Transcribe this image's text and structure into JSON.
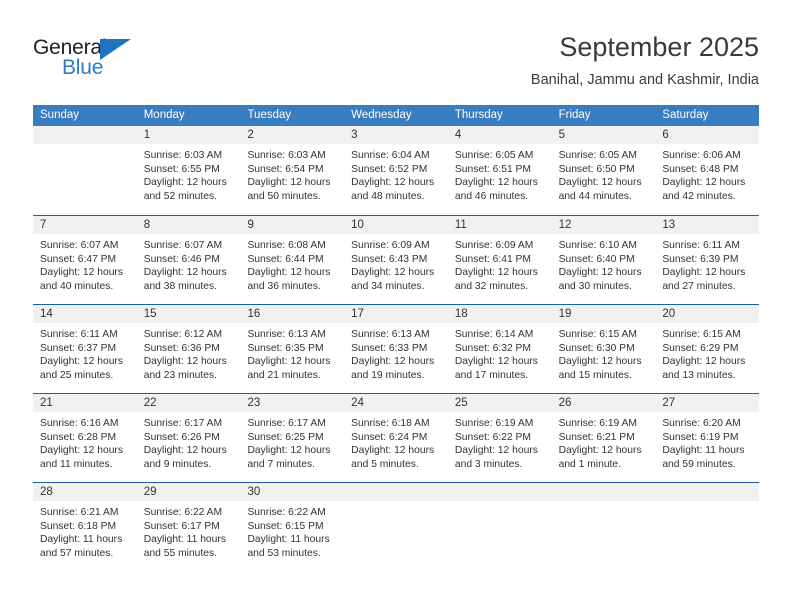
{
  "logo": {
    "general": "General",
    "blue": "Blue",
    "triangle_color": "#1f74bd"
  },
  "header": {
    "title": "September 2025",
    "subtitle": "Banihal, Jammu and Kashmir, India"
  },
  "theme": {
    "header_blue": "#3a7cc0",
    "separator_blue": "#1d5fa6",
    "day_band_gray": "#f1f1f1",
    "text": "#333333"
  },
  "weekdays": [
    "Sunday",
    "Monday",
    "Tuesday",
    "Wednesday",
    "Thursday",
    "Friday",
    "Saturday"
  ],
  "weeks": [
    [
      {
        "empty": true
      },
      {
        "day": "1",
        "sunrise": "Sunrise: 6:03 AM",
        "sunset": "Sunset: 6:55 PM",
        "daylight1": "Daylight: 12 hours",
        "daylight2": "and 52 minutes."
      },
      {
        "day": "2",
        "sunrise": "Sunrise: 6:03 AM",
        "sunset": "Sunset: 6:54 PM",
        "daylight1": "Daylight: 12 hours",
        "daylight2": "and 50 minutes."
      },
      {
        "day": "3",
        "sunrise": "Sunrise: 6:04 AM",
        "sunset": "Sunset: 6:52 PM",
        "daylight1": "Daylight: 12 hours",
        "daylight2": "and 48 minutes."
      },
      {
        "day": "4",
        "sunrise": "Sunrise: 6:05 AM",
        "sunset": "Sunset: 6:51 PM",
        "daylight1": "Daylight: 12 hours",
        "daylight2": "and 46 minutes."
      },
      {
        "day": "5",
        "sunrise": "Sunrise: 6:05 AM",
        "sunset": "Sunset: 6:50 PM",
        "daylight1": "Daylight: 12 hours",
        "daylight2": "and 44 minutes."
      },
      {
        "day": "6",
        "sunrise": "Sunrise: 6:06 AM",
        "sunset": "Sunset: 6:48 PM",
        "daylight1": "Daylight: 12 hours",
        "daylight2": "and 42 minutes."
      }
    ],
    [
      {
        "day": "7",
        "sunrise": "Sunrise: 6:07 AM",
        "sunset": "Sunset: 6:47 PM",
        "daylight1": "Daylight: 12 hours",
        "daylight2": "and 40 minutes."
      },
      {
        "day": "8",
        "sunrise": "Sunrise: 6:07 AM",
        "sunset": "Sunset: 6:46 PM",
        "daylight1": "Daylight: 12 hours",
        "daylight2": "and 38 minutes."
      },
      {
        "day": "9",
        "sunrise": "Sunrise: 6:08 AM",
        "sunset": "Sunset: 6:44 PM",
        "daylight1": "Daylight: 12 hours",
        "daylight2": "and 36 minutes."
      },
      {
        "day": "10",
        "sunrise": "Sunrise: 6:09 AM",
        "sunset": "Sunset: 6:43 PM",
        "daylight1": "Daylight: 12 hours",
        "daylight2": "and 34 minutes."
      },
      {
        "day": "11",
        "sunrise": "Sunrise: 6:09 AM",
        "sunset": "Sunset: 6:41 PM",
        "daylight1": "Daylight: 12 hours",
        "daylight2": "and 32 minutes."
      },
      {
        "day": "12",
        "sunrise": "Sunrise: 6:10 AM",
        "sunset": "Sunset: 6:40 PM",
        "daylight1": "Daylight: 12 hours",
        "daylight2": "and 30 minutes."
      },
      {
        "day": "13",
        "sunrise": "Sunrise: 6:11 AM",
        "sunset": "Sunset: 6:39 PM",
        "daylight1": "Daylight: 12 hours",
        "daylight2": "and 27 minutes."
      }
    ],
    [
      {
        "day": "14",
        "sunrise": "Sunrise: 6:11 AM",
        "sunset": "Sunset: 6:37 PM",
        "daylight1": "Daylight: 12 hours",
        "daylight2": "and 25 minutes."
      },
      {
        "day": "15",
        "sunrise": "Sunrise: 6:12 AM",
        "sunset": "Sunset: 6:36 PM",
        "daylight1": "Daylight: 12 hours",
        "daylight2": "and 23 minutes."
      },
      {
        "day": "16",
        "sunrise": "Sunrise: 6:13 AM",
        "sunset": "Sunset: 6:35 PM",
        "daylight1": "Daylight: 12 hours",
        "daylight2": "and 21 minutes."
      },
      {
        "day": "17",
        "sunrise": "Sunrise: 6:13 AM",
        "sunset": "Sunset: 6:33 PM",
        "daylight1": "Daylight: 12 hours",
        "daylight2": "and 19 minutes."
      },
      {
        "day": "18",
        "sunrise": "Sunrise: 6:14 AM",
        "sunset": "Sunset: 6:32 PM",
        "daylight1": "Daylight: 12 hours",
        "daylight2": "and 17 minutes."
      },
      {
        "day": "19",
        "sunrise": "Sunrise: 6:15 AM",
        "sunset": "Sunset: 6:30 PM",
        "daylight1": "Daylight: 12 hours",
        "daylight2": "and 15 minutes."
      },
      {
        "day": "20",
        "sunrise": "Sunrise: 6:15 AM",
        "sunset": "Sunset: 6:29 PM",
        "daylight1": "Daylight: 12 hours",
        "daylight2": "and 13 minutes."
      }
    ],
    [
      {
        "day": "21",
        "sunrise": "Sunrise: 6:16 AM",
        "sunset": "Sunset: 6:28 PM",
        "daylight1": "Daylight: 12 hours",
        "daylight2": "and 11 minutes."
      },
      {
        "day": "22",
        "sunrise": "Sunrise: 6:17 AM",
        "sunset": "Sunset: 6:26 PM",
        "daylight1": "Daylight: 12 hours",
        "daylight2": "and 9 minutes."
      },
      {
        "day": "23",
        "sunrise": "Sunrise: 6:17 AM",
        "sunset": "Sunset: 6:25 PM",
        "daylight1": "Daylight: 12 hours",
        "daylight2": "and 7 minutes."
      },
      {
        "day": "24",
        "sunrise": "Sunrise: 6:18 AM",
        "sunset": "Sunset: 6:24 PM",
        "daylight1": "Daylight: 12 hours",
        "daylight2": "and 5 minutes."
      },
      {
        "day": "25",
        "sunrise": "Sunrise: 6:19 AM",
        "sunset": "Sunset: 6:22 PM",
        "daylight1": "Daylight: 12 hours",
        "daylight2": "and 3 minutes."
      },
      {
        "day": "26",
        "sunrise": "Sunrise: 6:19 AM",
        "sunset": "Sunset: 6:21 PM",
        "daylight1": "Daylight: 12 hours",
        "daylight2": "and 1 minute."
      },
      {
        "day": "27",
        "sunrise": "Sunrise: 6:20 AM",
        "sunset": "Sunset: 6:19 PM",
        "daylight1": "Daylight: 11 hours",
        "daylight2": "and 59 minutes."
      }
    ],
    [
      {
        "day": "28",
        "sunrise": "Sunrise: 6:21 AM",
        "sunset": "Sunset: 6:18 PM",
        "daylight1": "Daylight: 11 hours",
        "daylight2": "and 57 minutes."
      },
      {
        "day": "29",
        "sunrise": "Sunrise: 6:22 AM",
        "sunset": "Sunset: 6:17 PM",
        "daylight1": "Daylight: 11 hours",
        "daylight2": "and 55 minutes."
      },
      {
        "day": "30",
        "sunrise": "Sunrise: 6:22 AM",
        "sunset": "Sunset: 6:15 PM",
        "daylight1": "Daylight: 11 hours",
        "daylight2": "and 53 minutes."
      },
      {
        "empty": true
      },
      {
        "empty": true
      },
      {
        "empty": true
      },
      {
        "empty": true
      }
    ]
  ]
}
